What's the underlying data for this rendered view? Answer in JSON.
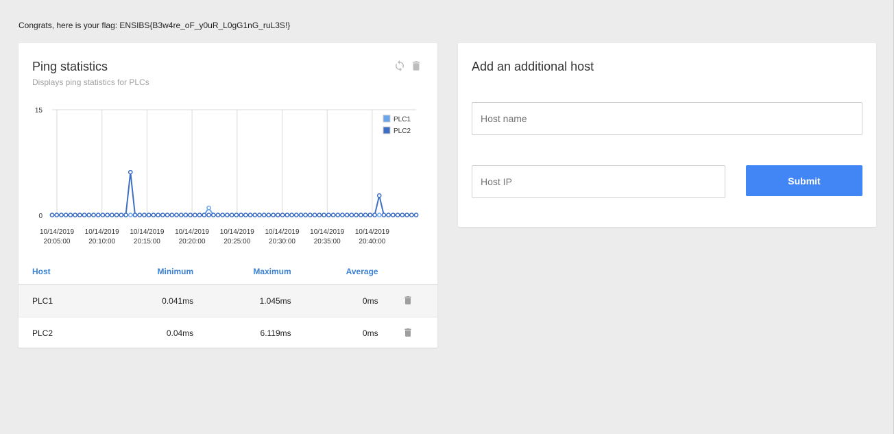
{
  "flag_message": "Congrats, here is your flag: ENSIBS{B3w4re_oF_y0uR_L0gG1nG_ruL3S!}",
  "ping_card": {
    "title": "Ping statistics",
    "subtitle": "Displays ping statistics for PLCs",
    "icons": [
      "refresh-icon",
      "trash-icon"
    ]
  },
  "chart_data": {
    "type": "line",
    "title": "",
    "xlabel": "",
    "ylabel": "",
    "ylim": [
      0,
      15
    ],
    "y_ticks": [
      "0",
      "15"
    ],
    "x_ticks": [
      [
        "10/14/2019",
        "20:05:00"
      ],
      [
        "10/14/2019",
        "20:10:00"
      ],
      [
        "10/14/2019",
        "20:15:00"
      ],
      [
        "10/14/2019",
        "20:20:00"
      ],
      [
        "10/14/2019",
        "20:25:00"
      ],
      [
        "10/14/2019",
        "20:30:00"
      ],
      [
        "10/14/2019",
        "20:35:00"
      ],
      [
        "10/14/2019",
        "20:40:00"
      ]
    ],
    "x_range_minutes": [
      20.08,
      21.0
    ],
    "grid": true,
    "legend_position": "top-right",
    "series": [
      {
        "name": "PLC1",
        "color": "#6aa4ea",
        "sample_start": "20:05:00",
        "sample_interval_seconds": 20,
        "peaks": [
          {
            "index": 34,
            "value": 1.045
          }
        ],
        "baseline": 0.041
      },
      {
        "name": "PLC2",
        "color": "#3f6fc2",
        "sample_start": "20:05:00",
        "sample_interval_seconds": 20,
        "peaks": [
          {
            "index": 17,
            "value": 6.119
          },
          {
            "index": 71,
            "value": 2.8
          }
        ],
        "baseline": 0.04
      }
    ],
    "num_samples": 80
  },
  "stats_table": {
    "headers": {
      "host": "Host",
      "min": "Minimum",
      "max": "Maximum",
      "avg": "Average"
    },
    "rows": [
      {
        "host": "PLC1",
        "min": "0.041ms",
        "max": "1.045ms",
        "avg": "0ms"
      },
      {
        "host": "PLC2",
        "min": "0.04ms",
        "max": "6.119ms",
        "avg": "0ms"
      }
    ]
  },
  "host_form": {
    "title": "Add an additional host",
    "host_name_placeholder": "Host name",
    "host_ip_placeholder": "Host IP",
    "submit_label": "Submit",
    "accent_color": "#4285f4"
  }
}
